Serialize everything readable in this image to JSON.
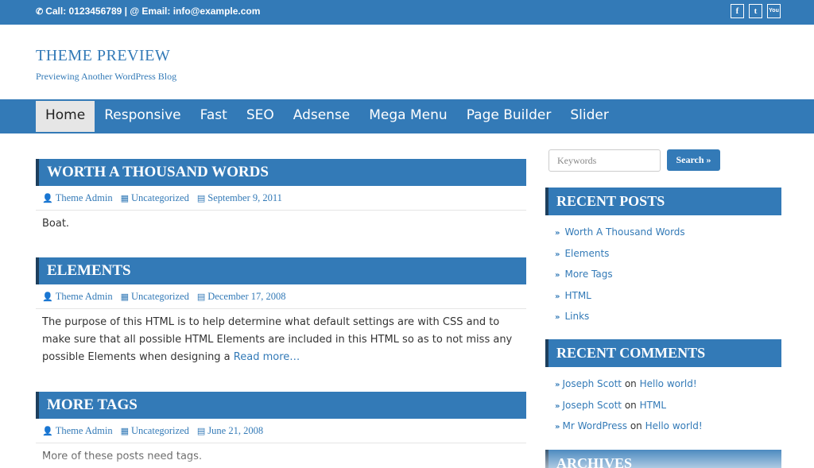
{
  "topbar": {
    "contact": "Call: 0123456789 | @ Email: info@example.com",
    "social": [
      {
        "icon": "facebook-icon",
        "glyph": "f"
      },
      {
        "icon": "twitter-icon",
        "glyph": "t"
      },
      {
        "icon": "youtube-icon",
        "glyph": "You"
      }
    ]
  },
  "header": {
    "title": "THEME PREVIEW",
    "description": "Previewing Another WordPress Blog"
  },
  "nav": {
    "items": [
      "Home",
      "Responsive",
      "Fast",
      "SEO",
      "Adsense",
      "Mega Menu",
      "Page Builder",
      "Slider"
    ],
    "active": "Home"
  },
  "posts": [
    {
      "title": "WORTH A THOUSAND WORDS",
      "author": "Theme Admin",
      "category": "Uncategorized",
      "date": "September 9, 2011",
      "excerpt": "Boat."
    },
    {
      "title": "ELEMENTS",
      "author": "Theme Admin",
      "category": "Uncategorized",
      "date": "December 17, 2008",
      "excerpt": "The purpose of this HTML is to help determine what default settings are with CSS and to make sure that all possible HTML Elements are included in this HTML so as to not miss any possible Elements when designing a",
      "read_more": "Read more…"
    },
    {
      "title": "MORE TAGS",
      "author": "Theme Admin",
      "category": "Uncategorized",
      "date": "June 21, 2008",
      "excerpt": "More of these posts need tags."
    }
  ],
  "sidebar": {
    "search": {
      "placeholder": "Keywords",
      "button": "Search »"
    },
    "recent_posts": {
      "title": "RECENT POSTS",
      "items": [
        "Worth A Thousand Words",
        "Elements",
        "More Tags",
        "HTML",
        "Links"
      ]
    },
    "recent_comments": {
      "title": "RECENT COMMENTS",
      "items": [
        {
          "author": "Joseph Scott",
          "on": "on",
          "post": "Hello world!"
        },
        {
          "author": "Joseph Scott",
          "on": "on",
          "post": "HTML"
        },
        {
          "author": "Mr WordPress",
          "on": "on",
          "post": "Hello world!"
        }
      ]
    },
    "archives": {
      "title": "ARCHIVES"
    }
  },
  "colors": {
    "primary": "#337ab7",
    "dark_accent": "#1d3f5e",
    "nav_active_bg": "#e6e6e6"
  }
}
